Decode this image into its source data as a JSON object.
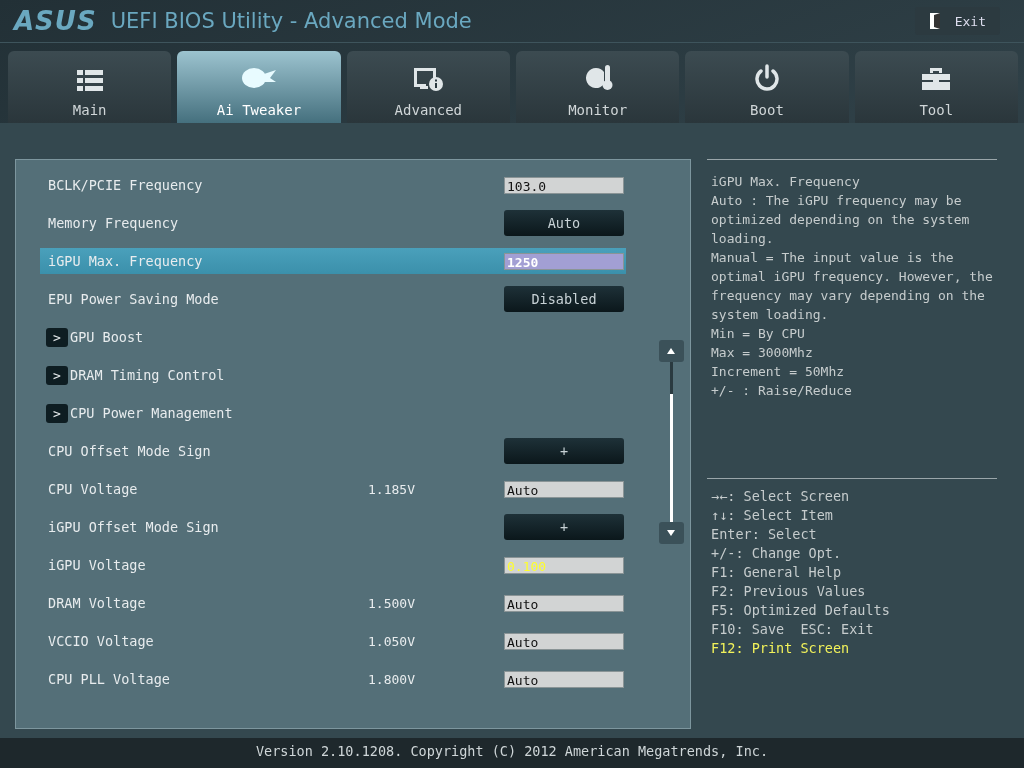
{
  "header": {
    "logo": "ASUS",
    "title": "UEFI BIOS Utility - Advanced Mode",
    "exit_label": "Exit"
  },
  "tabs": [
    {
      "label": "Main",
      "kind": "list",
      "selected": false
    },
    {
      "label": "Ai Tweaker",
      "kind": "tweak",
      "selected": true
    },
    {
      "label": "Advanced",
      "kind": "advanced",
      "selected": false
    },
    {
      "label": "Monitor",
      "kind": "monitor",
      "selected": false
    },
    {
      "label": "Boot",
      "kind": "power",
      "selected": false
    },
    {
      "label": "Tool",
      "kind": "toolbox",
      "selected": false
    }
  ],
  "settings": [
    {
      "kind": "input",
      "label": "BCLK/PCIE Frequency",
      "value": "103.0",
      "selected": false,
      "emphasized": false
    },
    {
      "kind": "button",
      "label": "Memory Frequency",
      "value": "Auto",
      "selected": false
    },
    {
      "kind": "input",
      "label": "iGPU Max. Frequency",
      "value": "1250",
      "selected": true,
      "emphasized": false
    },
    {
      "kind": "button",
      "label": "EPU Power Saving Mode",
      "value": "Disabled",
      "selected": false
    },
    {
      "kind": "submenu",
      "label": "GPU Boost",
      "arrow": ">",
      "selected": false
    },
    {
      "kind": "submenu",
      "label": "DRAM Timing Control",
      "arrow": ">",
      "selected": false
    },
    {
      "kind": "submenu",
      "label": "CPU Power Management",
      "arrow": ">",
      "selected": false
    },
    {
      "kind": "button",
      "label": "CPU Offset Mode Sign",
      "value": "+",
      "selected": false
    },
    {
      "kind": "input",
      "label": "CPU Voltage",
      "reading": "1.185V",
      "value": "Auto",
      "selected": false,
      "emphasized": false
    },
    {
      "kind": "button",
      "label": "iGPU Offset Mode Sign",
      "value": "+",
      "selected": false
    },
    {
      "kind": "input",
      "label": "iGPU Voltage",
      "value": "0.100",
      "selected": false,
      "emphasized": true
    },
    {
      "kind": "input",
      "label": "DRAM Voltage",
      "reading": "1.500V",
      "value": "Auto",
      "selected": false,
      "emphasized": false
    },
    {
      "kind": "input",
      "label": "VCCIO Voltage",
      "reading": "1.050V",
      "value": "Auto",
      "selected": false,
      "emphasized": false
    },
    {
      "kind": "input",
      "label": "CPU PLL Voltage",
      "reading": "1.800V",
      "value": "Auto",
      "selected": false,
      "emphasized": false
    }
  ],
  "help": {
    "description": [
      "iGPU Max. Frequency",
      "Auto : The iGPU frequency may be optimized depending on the system loading.",
      "Manual = The input value is the optimal iGPU frequency. However, the frequency may vary depending on the system loading.",
      "Min = By CPU",
      "Max = 3000Mhz",
      "Increment = 50Mhz",
      "+/- : Raise/Reduce"
    ],
    "keys": [
      {
        "text": "→←: Select Screen",
        "highlighted": false
      },
      {
        "text": "↑↓: Select Item",
        "highlighted": false
      },
      {
        "text": "Enter: Select",
        "highlighted": false
      },
      {
        "text": "+/-: Change Opt.",
        "highlighted": false
      },
      {
        "text": "F1: General Help",
        "highlighted": false
      },
      {
        "text": "F2: Previous Values",
        "highlighted": false
      },
      {
        "text": "F5: Optimized Defaults",
        "highlighted": false
      },
      {
        "text": "F10: Save  ESC: Exit",
        "highlighted": false
      },
      {
        "text": "F12: Print Screen",
        "highlighted": true
      }
    ]
  },
  "footer": "Version 2.10.1208. Copyright (C) 2012 American Megatrends, Inc."
}
